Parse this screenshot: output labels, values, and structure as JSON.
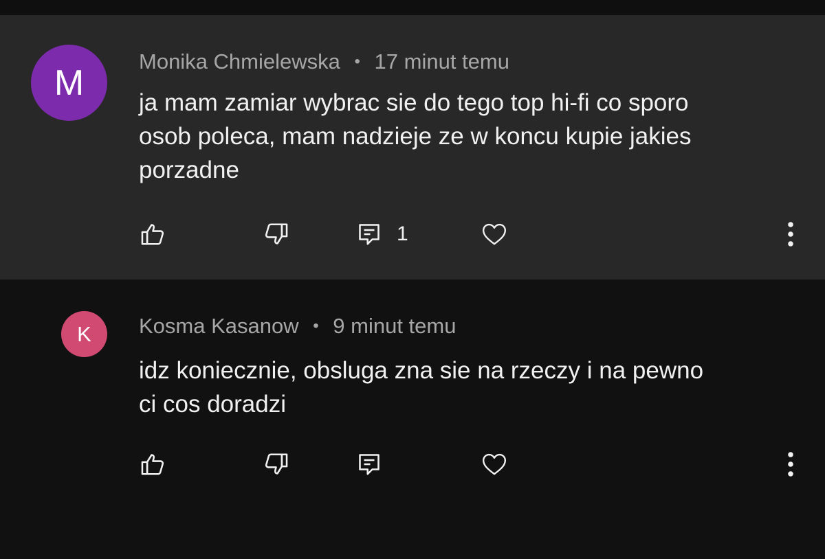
{
  "comments": [
    {
      "avatar_letter": "M",
      "avatar_color": "#7b2bab",
      "author": "Monika Chmielewska",
      "separator": "•",
      "time": "17 minut temu",
      "text": "ja mam zamiar wybrac sie do tego top hi-fi co sporo\nosob poleca, mam nadzieje ze w koncu kupie jakies\nporzadne",
      "reply_count": "1",
      "background": "#282828"
    },
    {
      "avatar_letter": "K",
      "avatar_color": "#d14a72",
      "author": "Kosma Kasanow",
      "separator": "•",
      "time": "9 minut temu",
      "text": "idz koniecznie, obsluga zna sie na rzeczy i na pewno\nci cos doradzi",
      "reply_count": "",
      "background": "#111111"
    }
  ],
  "icons": {
    "like": "thumbs-up-icon",
    "dislike": "thumbs-down-icon",
    "reply": "comment-icon",
    "heart": "heart-icon",
    "more": "more-vertical-icon"
  },
  "colors": {
    "icon": "#f1f1f1",
    "meta_text": "#a7a7a7",
    "body_text": "#f1f1f1"
  }
}
